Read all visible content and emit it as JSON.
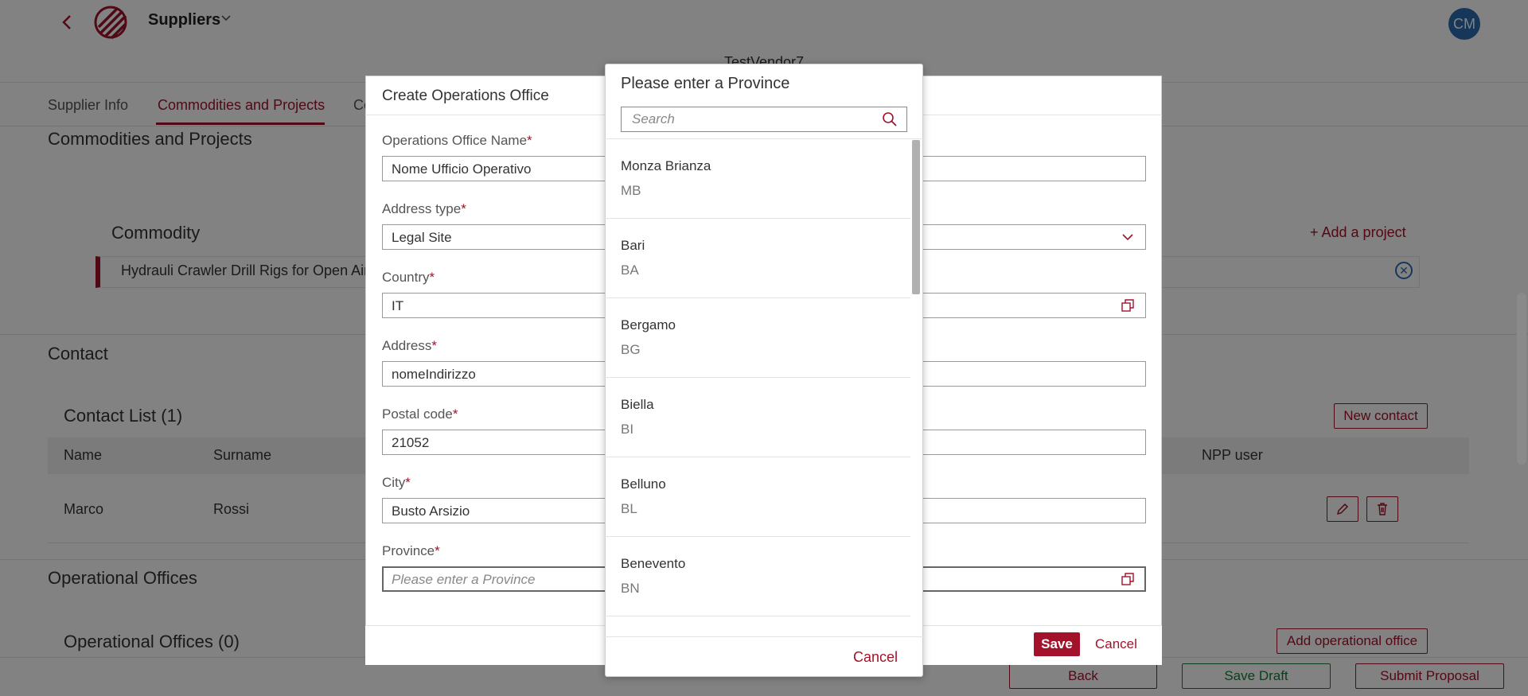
{
  "header": {
    "app_title": "Suppliers",
    "avatar_initials": "CM",
    "vendor_name": "TestVendor7"
  },
  "tabs": [
    {
      "label": "Supplier Info"
    },
    {
      "label": "Commodities and Projects"
    },
    {
      "label": "Co"
    }
  ],
  "commodities_section": {
    "title": "Commodities and Projects",
    "commodity_header": "Commodity",
    "add_project_label": "+ Add a project",
    "commodity_item": "Hydrauli Crawler Drill Rigs for Open Air"
  },
  "contact_section": {
    "title": "Contact",
    "list_title": "Contact List (1)",
    "new_contact_label": "New contact",
    "columns": [
      "Name",
      "Surname",
      "NPP user"
    ],
    "rows": [
      {
        "name": "Marco",
        "surname": "Rossi"
      }
    ]
  },
  "offices_section": {
    "title": "Operational Offices",
    "list_title": "Operational Offices (0)",
    "add_label": "Add operational office"
  },
  "footer": {
    "back_label": "Back",
    "save_draft_label": "Save Draft",
    "submit_label": "Submit Proposal"
  },
  "modal": {
    "title": "Create Operations Office",
    "fields": {
      "office_name": {
        "label": "Operations Office Name",
        "value": "Nome Ufficio Operativo"
      },
      "address_type": {
        "label": "Address type",
        "value": "Legal Site"
      },
      "country": {
        "label": "Country",
        "value": "IT"
      },
      "address": {
        "label": "Address",
        "value": "nomeIndirizzo"
      },
      "postal_code": {
        "label": "Postal code",
        "value": "21052"
      },
      "city": {
        "label": "City",
        "value": "Busto Arsizio"
      },
      "province": {
        "label": "Province",
        "placeholder": "Please enter a Province"
      }
    },
    "save_label": "Save",
    "cancel_label": "Cancel",
    "required_marker": "*"
  },
  "province_picker": {
    "title": "Please enter a Province",
    "search_placeholder": "Search",
    "cancel_label": "Cancel",
    "items": [
      {
        "name": "Monza Brianza",
        "code": "MB"
      },
      {
        "name": "Bari",
        "code": "BA"
      },
      {
        "name": "Bergamo",
        "code": "BG"
      },
      {
        "name": "Biella",
        "code": "BI"
      },
      {
        "name": "Belluno",
        "code": "BL"
      },
      {
        "name": "Benevento",
        "code": "BN"
      }
    ]
  },
  "colors": {
    "accent": "#a3122a",
    "avatar": "#2b6cb0",
    "success": "#1d7a3a"
  }
}
